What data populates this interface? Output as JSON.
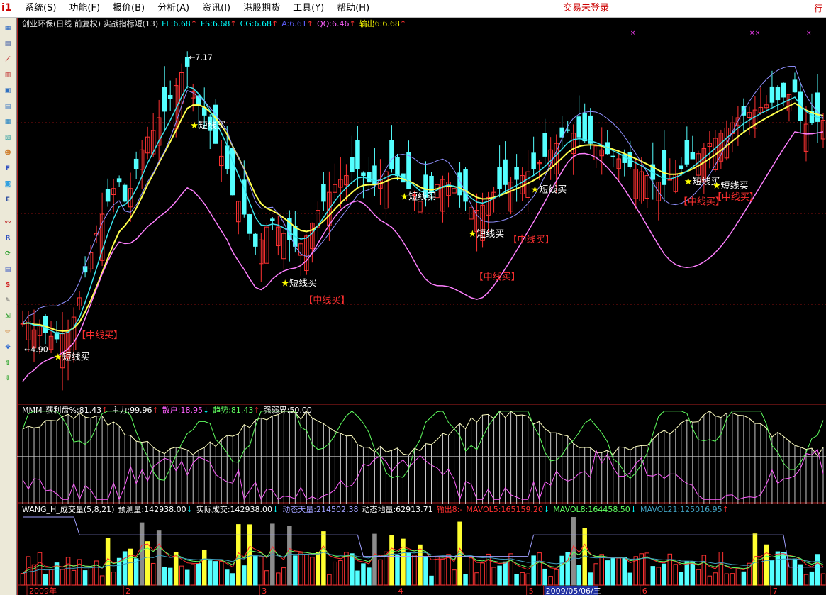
{
  "menubar": {
    "items": [
      "系统(S)",
      "功能(F)",
      "报价(B)",
      "分析(A)",
      "资讯(I)",
      "港股期货",
      "工具(Y)",
      "帮助(H)"
    ],
    "login_status": "交易未登录",
    "right_tab": "行"
  },
  "toolbar": {
    "icons": [
      "report-icon",
      "quote-list-icon",
      "trend-icon",
      "kline-icon",
      "multi-window-icon",
      "table-icon",
      "analysis-icon",
      "chart-icon",
      "users-icon",
      "f10-icon",
      "search-icon",
      "eit-icon",
      "indicator-icon",
      "rsi-icon",
      "refresh-icon",
      "list-icon",
      "dollar-icon",
      "tools-icon",
      "export-icon",
      "pencil-icon",
      "move-icon",
      "arrow-up-icon",
      "arrow-down-icon"
    ]
  },
  "colors": {
    "up": "#ff3232",
    "down": "#54ffff",
    "ma_yellow": "#ffff4c",
    "ma_cyan": "#3ce6f0",
    "ma_lavender": "#9090ff",
    "ma_pink": "#ff7fff",
    "signal_star": "#ffff00",
    "signal_mid": "#ff3030",
    "grid": "#8a1010",
    "vol_gray": "#8c8c8c"
  },
  "main_panel": {
    "title": "创业环保(日线 前复权) 实战指标短(13)",
    "indicators": [
      {
        "text": "FL:6.68",
        "color": "#00ffff",
        "arrow": "↑"
      },
      {
        "text": "FS:6.68",
        "color": "#00ffff",
        "arrow": "↑"
      },
      {
        "text": "CG:6.68",
        "color": "#00ffff",
        "arrow": "↑"
      },
      {
        "text": "A:6.61",
        "color": "#6060ff",
        "arrow": "↑"
      },
      {
        "text": "QQ:6.46",
        "color": "#ff60ff",
        "arrow": "↑"
      },
      {
        "text": "输出6:6.68",
        "color": "#ffff00",
        "arrow": "↑"
      }
    ],
    "high_label": "7.17",
    "low_label": "4.90",
    "signals": [
      {
        "type": "star",
        "text": "短线买",
        "bar": 6
      },
      {
        "type": "mid",
        "text": "【中线买】",
        "bar": 10
      },
      {
        "type": "star",
        "text": "短线买",
        "bar": 30
      },
      {
        "type": "mid",
        "text": "【中线买】",
        "bar": 50
      },
      {
        "type": "star",
        "text": "短线买",
        "bar": 46
      },
      {
        "type": "star",
        "text": "短线买",
        "bar": 67
      },
      {
        "type": "star",
        "text": "短线买",
        "bar": 79
      },
      {
        "type": "mid",
        "text": "【中线买】",
        "bar": 80
      },
      {
        "type": "mid",
        "text": "【中线买】",
        "bar": 86
      },
      {
        "type": "star",
        "text": "短线买",
        "bar": 90
      },
      {
        "type": "star",
        "text": "短线买",
        "bar": 117
      },
      {
        "type": "star",
        "text": "短线买",
        "bar": 122
      },
      {
        "type": "mid",
        "text": "【中线买】",
        "bar": 116
      },
      {
        "type": "mid",
        "text": "【中线买】",
        "bar": 122
      }
    ]
  },
  "mmm_panel": {
    "title": "MMM",
    "items": [
      {
        "text": "获利盘%:81.43",
        "color": "#ffffff",
        "arrow": "↑"
      },
      {
        "text": "主力:99.96",
        "color": "#ffffff",
        "arrow": "↑"
      },
      {
        "text": "散户:18.95",
        "color": "#ff60ff",
        "arrow": "↓"
      },
      {
        "text": "趋势:81.43",
        "color": "#60ff60",
        "arrow": "↑"
      },
      {
        "text": "强弱界:50.00",
        "color": "#ffffff",
        "arrow": ""
      }
    ]
  },
  "vol_panel": {
    "title": "WANG_H_成交量(5,8,21)",
    "items": [
      {
        "text": "预测量:142938.00",
        "color": "#ffffff",
        "arrow": "↓"
      },
      {
        "text": "实际成交:142938.00",
        "color": "#ffffff",
        "arrow": "↓"
      },
      {
        "text": "动态天量:214502.38",
        "color": "#a0a0ff",
        "arrow": ""
      },
      {
        "text": "动态地量:62913.71",
        "color": "#ffffff",
        "arrow": ""
      },
      {
        "text": "输出8:-",
        "color": "#ff3030",
        "arrow": ""
      },
      {
        "text": "MAVOL5:165159.20",
        "color": "#ff3030",
        "arrow": "↓"
      },
      {
        "text": "MAVOL8:164458.50",
        "color": "#60ff60",
        "arrow": "↓"
      },
      {
        "text": "MAVOL21:125016.95",
        "color": "#40a0c0",
        "arrow": "↑"
      }
    ]
  },
  "date_axis": {
    "labels": [
      {
        "text": "2009年",
        "bar": 1
      },
      {
        "text": "2",
        "bar": 18
      },
      {
        "text": "3",
        "bar": 42
      },
      {
        "text": "4",
        "bar": 66
      },
      {
        "text": "5",
        "bar": 89
      },
      {
        "text": "2009/05/06/三",
        "bar": 92
      },
      {
        "text": "6",
        "bar": 109
      },
      {
        "text": "7",
        "bar": 132
      }
    ]
  },
  "chart_data": {
    "type": "candlestick",
    "bars": 142,
    "price_range": [
      4.5,
      7.4
    ],
    "close": [
      5.1,
      5.12,
      5.05,
      5.08,
      5.03,
      5.0,
      4.98,
      5.02,
      5.05,
      5.15,
      5.3,
      5.5,
      5.65,
      5.8,
      5.95,
      6.05,
      6.15,
      6.2,
      6.05,
      6.15,
      6.3,
      6.45,
      6.55,
      6.6,
      6.7,
      6.75,
      6.85,
      6.95,
      7.05,
      7.1,
      6.9,
      6.8,
      6.72,
      6.6,
      6.5,
      6.4,
      6.3,
      6.1,
      6.05,
      5.95,
      5.8,
      5.7,
      5.75,
      5.85,
      5.9,
      5.85,
      5.8,
      5.75,
      5.7,
      5.72,
      5.78,
      5.88,
      5.98,
      6.05,
      6.12,
      6.18,
      6.22,
      6.25,
      6.28,
      6.3,
      6.25,
      6.2,
      6.18,
      6.22,
      6.28,
      6.3,
      6.25,
      6.2,
      6.15,
      6.1,
      6.05,
      6.08,
      6.12,
      6.18,
      6.22,
      6.2,
      6.15,
      6.1,
      6.05,
      6.0,
      5.98,
      6.02,
      6.08,
      6.12,
      6.15,
      6.18,
      6.2,
      6.22,
      6.25,
      6.28,
      6.3,
      6.35,
      6.4,
      6.45,
      6.5,
      6.55,
      6.6,
      6.58,
      6.55,
      6.52,
      6.5,
      6.48,
      6.45,
      6.42,
      6.4,
      6.38,
      6.35,
      6.32,
      6.3,
      6.28,
      6.25,
      6.22,
      6.2,
      6.18,
      6.22,
      6.26,
      6.3,
      6.34,
      6.38,
      6.42,
      6.46,
      6.5,
      6.54,
      6.58,
      6.62,
      6.66,
      6.7,
      6.72,
      6.74,
      6.76,
      6.78,
      6.8,
      6.82,
      6.84,
      6.86,
      6.88,
      6.9,
      6.68,
      6.65,
      6.66,
      6.67,
      6.68
    ],
    "series": [
      {
        "name": "FL",
        "color": "#ffff4c"
      },
      {
        "name": "FS",
        "color": "#3ce6f0"
      },
      {
        "name": "A",
        "color": "#9090ff"
      },
      {
        "name": "QQ",
        "color": "#ff7fff"
      }
    ]
  }
}
